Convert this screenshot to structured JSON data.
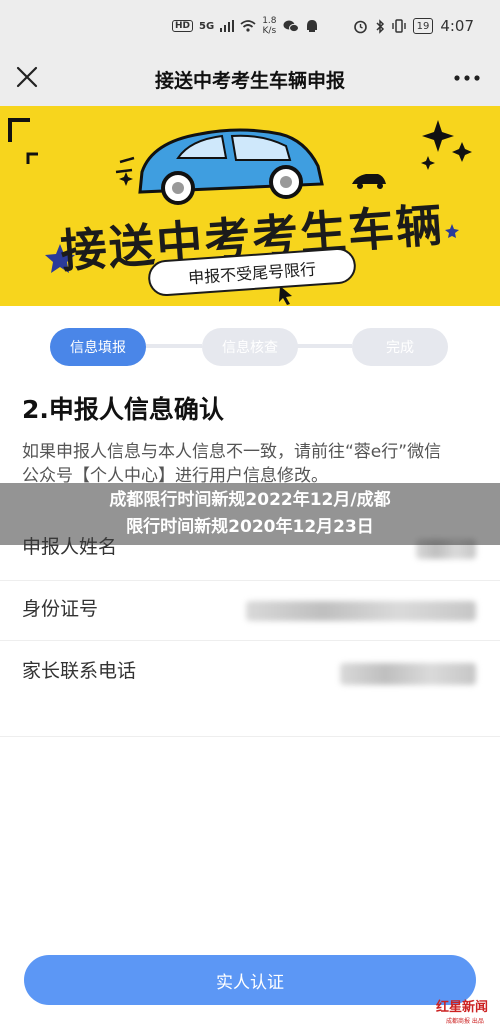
{
  "status_bar": {
    "hd": "HD",
    "network": "5G",
    "speed": "1.8",
    "speed_unit": "K/s",
    "battery": "19",
    "time": "4:07"
  },
  "nav": {
    "title": "接送中考考生车辆申报",
    "close_icon": "close-icon",
    "more_icon": "more-icon"
  },
  "banner": {
    "title": "接送中考考生车辆",
    "pill": "申报不受尾号限行"
  },
  "stepper": {
    "steps": [
      {
        "label": "信息填报",
        "state": "active"
      },
      {
        "label": "信息核查",
        "state": "inactive"
      },
      {
        "label": "完成",
        "state": "inactive"
      }
    ]
  },
  "section": {
    "title": "2.申报人信息确认",
    "notice": "如果申报人信息与本人信息不一致，请前往“蓉e行”微信公众号【个人中心】进行用户信息修改。"
  },
  "overlay": {
    "line1": "成都限行时间新规2022年12月/成都",
    "line2": "限行时间新规2020年12月23日"
  },
  "fields": [
    {
      "label": "申报人姓名"
    },
    {
      "label": "身份证号"
    },
    {
      "label": "家长联系电话"
    }
  ],
  "submit": {
    "label": "实人认证"
  },
  "watermark": {
    "text": "红星新闻",
    "sub": "成都商报 出品"
  },
  "colors": {
    "accent": "#4a86e8",
    "banner": "#f7d51d",
    "button": "#5c97f5"
  }
}
